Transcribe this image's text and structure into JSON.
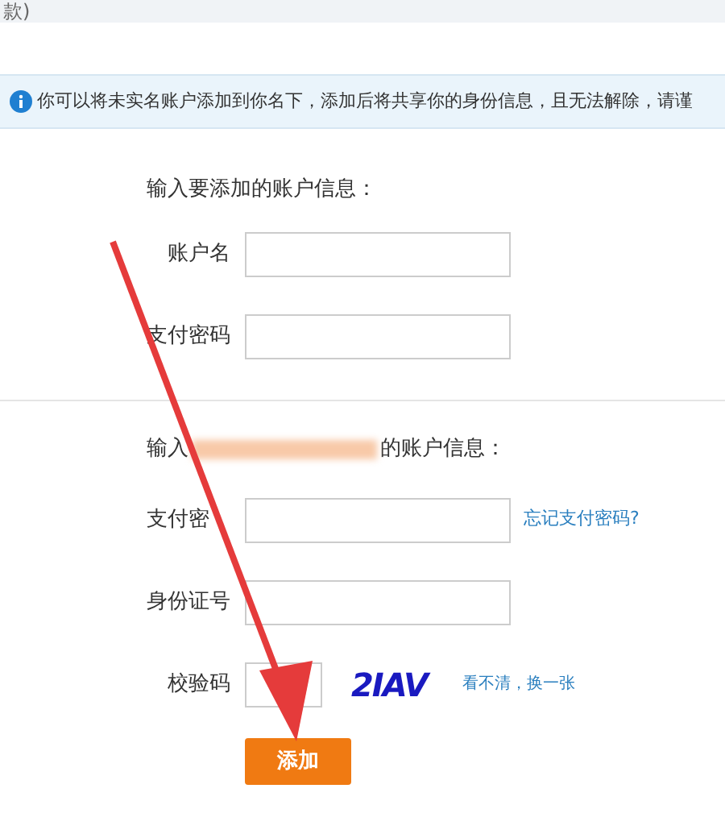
{
  "top_bar": {
    "text": "款)"
  },
  "notice": {
    "text": "你可以将未实名账户添加到你名下，添加后将共享你的身份信息，且无法解除，请谨"
  },
  "section_1": {
    "heading": "输入要添加的账户信息：",
    "fields": [
      {
        "label": "账户名"
      },
      {
        "label": "支付密码"
      }
    ]
  },
  "section_2": {
    "heading_before": "输入",
    "heading_after": "的账户信息：",
    "fields": [
      {
        "label": "支付密",
        "kind": "link",
        "link": "忘记支付密码?"
      },
      {
        "label": "身份证号",
        "kind": "plain"
      },
      {
        "label": "校验码",
        "kind": "captcha",
        "captcha": "2IAV",
        "link": "看不清，换一张"
      }
    ]
  },
  "submit": {
    "label": "添加"
  }
}
